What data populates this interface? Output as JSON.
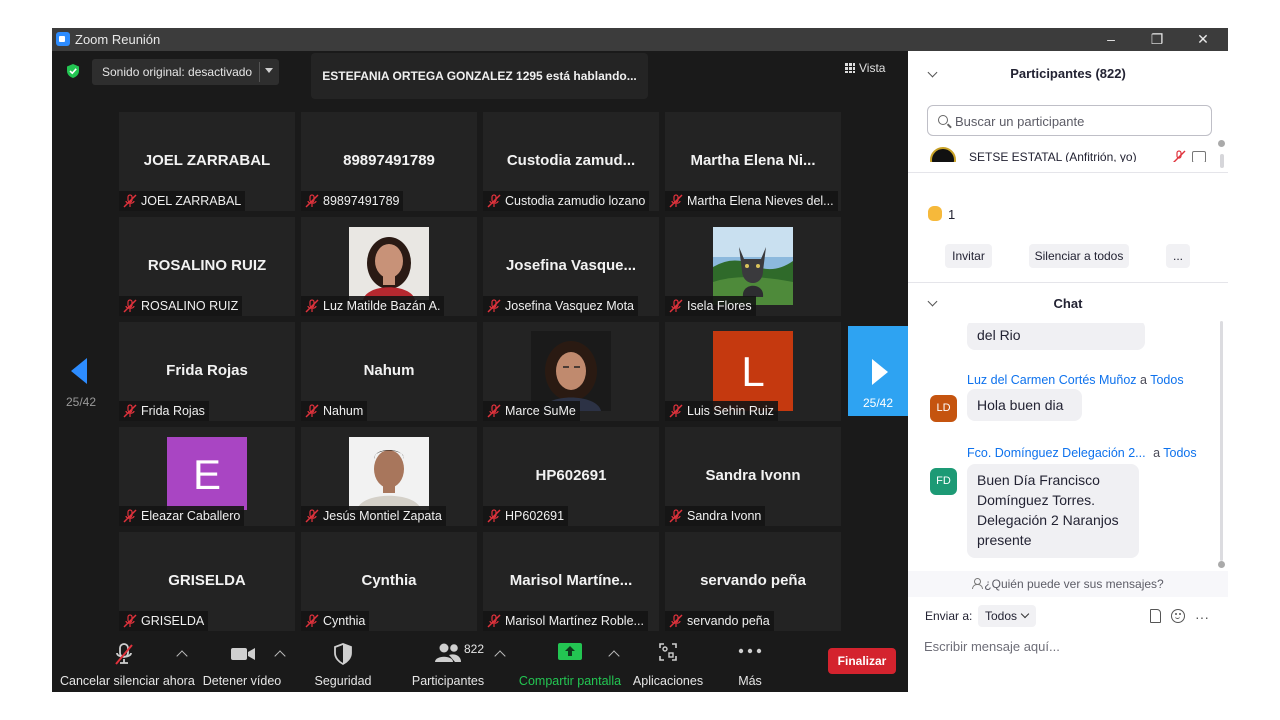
{
  "window": {
    "title": "Zoom Reunión",
    "controls": [
      "–",
      "❐",
      "✕"
    ]
  },
  "top": {
    "audio_label": "Sonido original: desactivado",
    "speaking": "ESTEFANIA ORTEGA GONZALEZ 1295 está hablando...",
    "view_label": "Vista"
  },
  "pager": {
    "left": "25/42",
    "right": "25/42"
  },
  "tiles": [
    {
      "big": "JOEL ZARRABAL",
      "name": "JOEL ZARRABAL"
    },
    {
      "big": "89897491789",
      "name": "89897491789"
    },
    {
      "big": "Custodia  zamud...",
      "name": "Custodia zamudio lozano"
    },
    {
      "big": "Martha Elena Ni...",
      "name": "Martha Elena Nieves del..."
    },
    {
      "big": "ROSALINO RUIZ",
      "name": "ROSALINO RUIZ"
    },
    {
      "big": "",
      "name": "Luz Matilde Bazán A.",
      "photo": "woman-portrait"
    },
    {
      "big": "Josefina  Vasque...",
      "name": "Josefina Vasquez Mota"
    },
    {
      "big": "",
      "name": "Isela Flores",
      "photo": "cat-photo"
    },
    {
      "big": "Frida Rojas",
      "name": "Frida Rojas"
    },
    {
      "big": "Nahum",
      "name": "Nahum"
    },
    {
      "big": "",
      "name": "Marce SuMe",
      "photo": "woman-selfie"
    },
    {
      "big": "",
      "name": "Luis Sehin Ruiz",
      "letter": "L",
      "letter_color": "#c5390f"
    },
    {
      "big": "",
      "name": "Eleazar Caballero",
      "letter": "E",
      "letter_color": "#a945c3"
    },
    {
      "big": "",
      "name": "Jesús Montiel Zapata",
      "photo": "man-portrait"
    },
    {
      "big": "HP602691",
      "name": "HP602691"
    },
    {
      "big": "Sandra Ivonn",
      "name": "Sandra Ivonn"
    },
    {
      "big": "GRISELDA",
      "name": "GRISELDA"
    },
    {
      "big": "Cynthia",
      "name": "Cynthia"
    },
    {
      "big": "Marisol  Martíne...",
      "name": "Marisol Martínez Roble..."
    },
    {
      "big": "servando peña",
      "name": "servando peña"
    }
  ],
  "toolbar": {
    "unmute": "Cancelar silenciar ahora",
    "video": "Detener vídeo",
    "security": "Seguridad",
    "participants": "Participantes",
    "participants_count": "822",
    "share": "Compartir pantalla",
    "apps": "Aplicaciones",
    "more": "Más",
    "end": "Finalizar"
  },
  "panel": {
    "participants_title": "Participantes (822)",
    "search_placeholder": "Buscar un participante",
    "host_name": "SETSE ESTATAL (Anfitrión, yo)",
    "raised_hands": "1",
    "invite": "Invitar",
    "mute_all": "Silenciar a todos",
    "more": "...",
    "chat_title": "Chat",
    "messages": [
      {
        "text": "del Rio"
      },
      {
        "sender": "Luz del Carmen Cortés Muñoz",
        "a": "a",
        "to": "Todos",
        "initials": "LD",
        "color": "#c5540f",
        "text": "Hola buen dia"
      },
      {
        "sender": "Fco. Domínguez Delegación 2...",
        "a": "a",
        "to": "Todos",
        "initials": "FD",
        "color": "#1d9a75",
        "text": "Buen Día Francisco Domínguez Torres. Delegación 2 Naranjos presente"
      }
    ],
    "who_sees": "¿Quién puede ver sus mensajes?",
    "send_to_label": "Enviar a:",
    "send_to_value": "Todos",
    "compose_placeholder": "Escribir mensaje aquí..."
  }
}
